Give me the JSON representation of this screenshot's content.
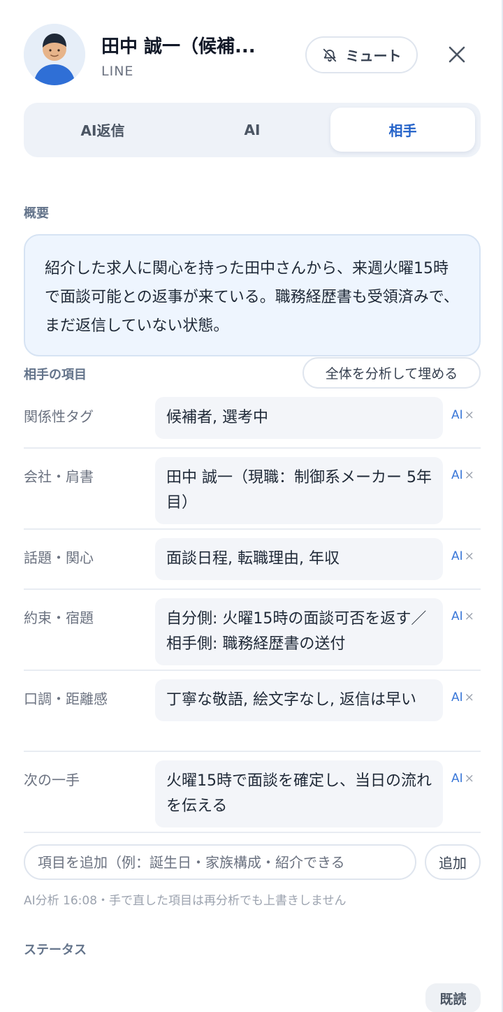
{
  "header": {
    "name": "田中 誠一（候補...",
    "source": "LINE",
    "mute_label": "ミュート"
  },
  "tabs": [
    {
      "label": "AI返信",
      "active": false
    },
    {
      "label": "AI",
      "active": false
    },
    {
      "label": "相手",
      "active": true
    }
  ],
  "summary": {
    "label": "概要",
    "text": "紹介した求人に関心を持った田中さんから、来週火曜15時で面談可能との返事が来ている。職務経歴書も受領済みで、まだ返信していない状態。"
  },
  "items_section": {
    "label": "相手の項目",
    "fill_button": "全体を分析して埋める",
    "ai_tag": "AI",
    "remove_glyph": "×",
    "items": [
      {
        "label": "関係性タグ",
        "value": "候補者, 選考中"
      },
      {
        "label": "会社・肩書",
        "value": "田中 誠一（現職：制御系メーカー 5年目）"
      },
      {
        "label": "話題・関心",
        "value": "面談日程, 転職理由, 年収"
      },
      {
        "label": "約束・宿題",
        "value": "自分側: 火曜15時の面談可否を返す／相手側: 職務経歴書の送付"
      },
      {
        "label": "口調・距離感",
        "value": "丁寧な敬語, 絵文字なし, 返信は早い"
      },
      {
        "label": "次の一手",
        "value": "火曜15時で面談を確定し、当日の流れを伝える"
      }
    ],
    "add_placeholder": "項目を追加（例：誕生日・家族構成・紹介できる",
    "add_button": "追加",
    "note": "AI分析 16:08・手で直した項目は再分析でも上書きしません"
  },
  "status": {
    "label": "ステータス",
    "badge": "既読"
  },
  "colors": {
    "accent": "#2563c9",
    "summary_bg": "#eef5fe",
    "field_bg": "#f3f5f9"
  }
}
